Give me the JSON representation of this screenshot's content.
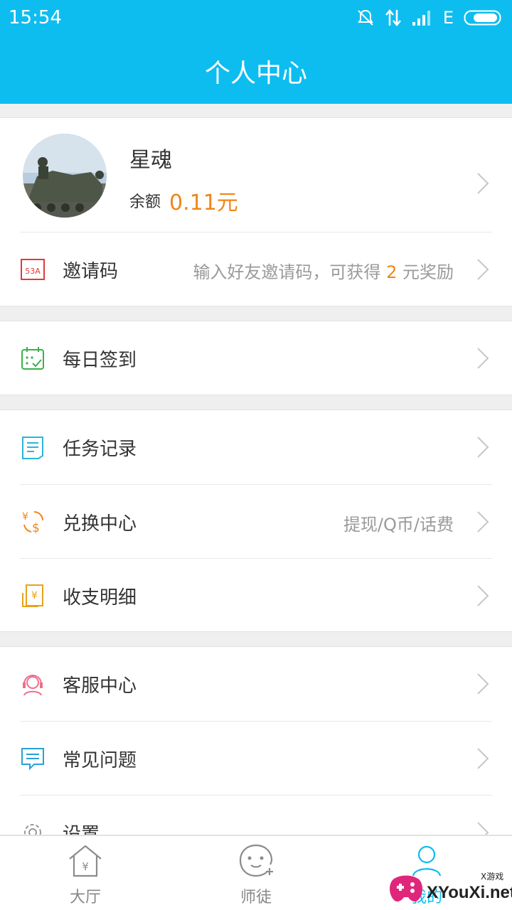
{
  "status_bar": {
    "time": "15:54",
    "network": "E"
  },
  "header": {
    "title": "个人中心"
  },
  "profile": {
    "name": "星魂",
    "balance_label": "余额",
    "balance_value": "0.11元"
  },
  "invite": {
    "label": "邀请码",
    "icon": "invite-code-icon",
    "hint_prefix": "输入好友邀请码，可获得 ",
    "hint_amount": "2",
    "hint_suffix": " 元奖励"
  },
  "menu": {
    "checkin": {
      "label": "每日签到",
      "icon": "calendar-check-icon"
    },
    "tasks": {
      "label": "任务记录",
      "icon": "task-list-icon"
    },
    "exchange": {
      "label": "兑换中心",
      "hint": "提现/Q币/话费",
      "icon": "currency-exchange-icon"
    },
    "ledger": {
      "label": "收支明细",
      "icon": "receipt-icon"
    },
    "support": {
      "label": "客服中心",
      "icon": "headset-icon"
    },
    "faq": {
      "label": "常见问题",
      "icon": "chat-bubble-icon"
    },
    "settings": {
      "label": "设置",
      "icon": "gear-icon"
    }
  },
  "tabs": [
    {
      "label": "大厅",
      "icon": "home-icon"
    },
    {
      "label": "师徒",
      "icon": "face-add-icon"
    },
    {
      "label": "我的",
      "icon": "person-icon"
    }
  ],
  "watermark": {
    "text": "XYouXi.net",
    "small": "X游戏"
  },
  "colors": {
    "primary": "#0dbdf0",
    "accent": "#f08619",
    "background": "#efeff0"
  }
}
